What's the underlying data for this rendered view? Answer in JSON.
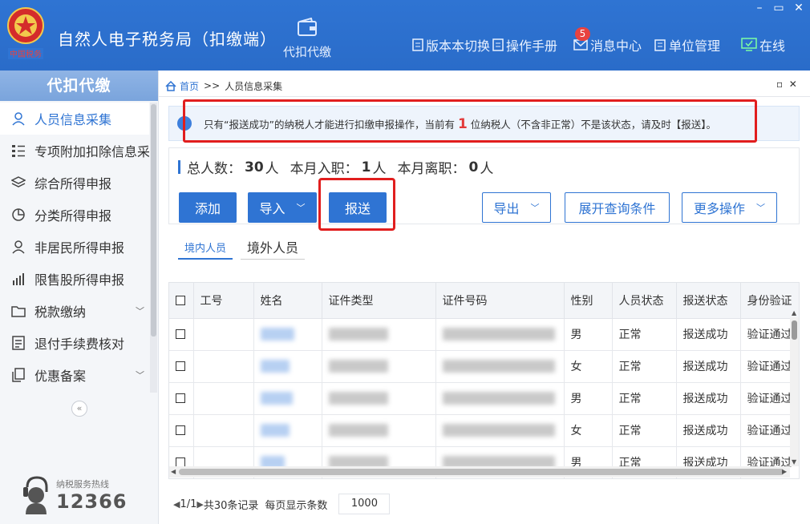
{
  "header": {
    "app_title": "自然人电子税务局（扣缴端）",
    "module_tab": "代扣代缴",
    "links": {
      "version_switch": "版本本切换",
      "manual": "操作手册",
      "messages": "消息中心",
      "unit_manage": "单位管理",
      "online": "在线"
    },
    "message_badge": "5"
  },
  "sidebar": {
    "title": "代扣代缴",
    "items": [
      {
        "label": "人员信息采集",
        "icon": "person-icon"
      },
      {
        "label": "专项附加扣除信息采",
        "icon": "list-icon"
      },
      {
        "label": "综合所得申报",
        "icon": "layers-icon"
      },
      {
        "label": "分类所得申报",
        "icon": "pie-icon"
      },
      {
        "label": "非居民所得申报",
        "icon": "person-outline-icon"
      },
      {
        "label": "限售股所得申报",
        "icon": "bar-chart-icon"
      },
      {
        "label": "税款缴纳",
        "icon": "folder-icon"
      },
      {
        "label": "退付手续费核对",
        "icon": "document-icon"
      },
      {
        "label": "优惠备案",
        "icon": "copy-icon"
      }
    ],
    "hotline_label": "纳税服务热线",
    "hotline_number": "12366"
  },
  "breadcrumb": {
    "home": "首页",
    "separator": ">>",
    "current": "人员信息采集"
  },
  "notice": {
    "before": "只有“报送成功”的纳税人才能进行扣缴申报操作，当前有",
    "count": "1",
    "after": "位纳税人（不含非正常）不是该状态，请及时【报送】。"
  },
  "stats": {
    "total_label": "总人数：",
    "total_value": "30",
    "join_label": "本月入职：",
    "join_value": "1",
    "leave_label": "本月离职：",
    "leave_value": "0",
    "unit": "人"
  },
  "toolbar": {
    "add": "添加",
    "import": "导入",
    "send": "报送",
    "export": "导出",
    "expand_query": "展开查询条件",
    "more": "更多操作"
  },
  "person_tabs": {
    "domestic": "境内人员",
    "foreign": "境外人员"
  },
  "table": {
    "headers": [
      "工号",
      "姓名",
      "证件类型",
      "证件号码",
      "性别",
      "人员状态",
      "报送状态",
      "身份验证"
    ],
    "rows": [
      {
        "gender": "男",
        "status": "正常",
        "send_status": "报送成功",
        "verify": "验证通过"
      },
      {
        "gender": "女",
        "status": "正常",
        "send_status": "报送成功",
        "verify": "验证通过"
      },
      {
        "gender": "男",
        "status": "正常",
        "send_status": "报送成功",
        "verify": "验证通过"
      },
      {
        "gender": "女",
        "status": "正常",
        "send_status": "报送成功",
        "verify": "验证通过"
      },
      {
        "gender": "男",
        "status": "正常",
        "send_status": "报送成功",
        "verify": "验证通过"
      }
    ]
  },
  "pager": {
    "page": "1/1",
    "total": "共30条记录",
    "page_size_label": "每页显示条数",
    "page_size": "1000"
  },
  "colors": {
    "brand_blue": "#2f74d3",
    "highlight_red": "#e11e1e",
    "badge_red": "#e8423f"
  }
}
